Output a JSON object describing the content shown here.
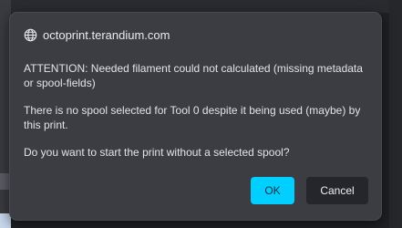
{
  "dialog": {
    "origin": "octoprint.terandium.com",
    "origin_icon": "globe-icon",
    "messages": [
      "ATTENTION: Needed filament could not calculated (missing metadata or spool-fields)",
      "There is no spool selected for Tool 0 despite it being used (maybe) by this print.",
      "Do you want to start the print without a selected spool?"
    ],
    "ok_label": "OK",
    "cancel_label": "Cancel"
  },
  "colors": {
    "dialog_bg": "#3c3c43",
    "ok_button": "#00cfff",
    "cancel_button": "#25262b"
  }
}
